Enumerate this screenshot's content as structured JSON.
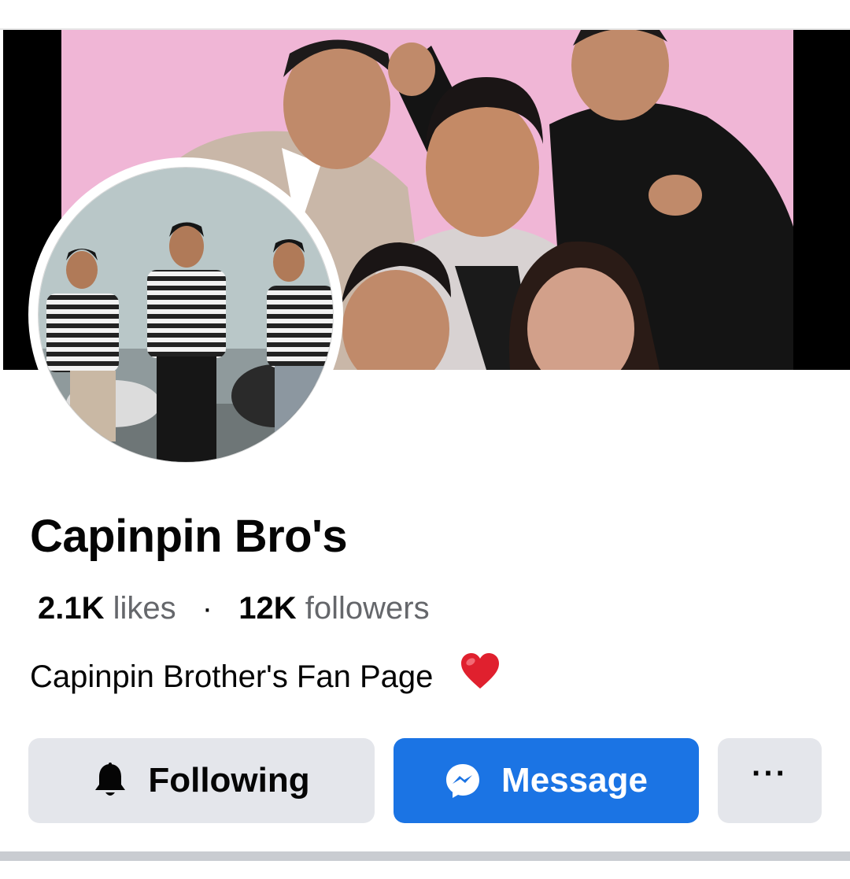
{
  "page": {
    "name": "Capinpin Bro's",
    "likes_count": "2.1K",
    "likes_label": "likes",
    "separator": "·",
    "followers_count": "12K",
    "followers_label": "followers",
    "bio": "Capinpin Brother's Fan Page"
  },
  "actions": {
    "following_label": "Following",
    "message_label": "Message",
    "more_label": "···"
  },
  "icons": {
    "following": "bell-icon",
    "message": "messenger-icon",
    "bio_emoji": "red-heart-icon",
    "more": "more-icon"
  },
  "colors": {
    "primary": "#1b74e4",
    "secondary_button": "#e4e6eb",
    "text_primary": "#050505",
    "text_secondary": "#65676b",
    "cover_background": "#f0b6d6",
    "heart": "#e0202e"
  }
}
